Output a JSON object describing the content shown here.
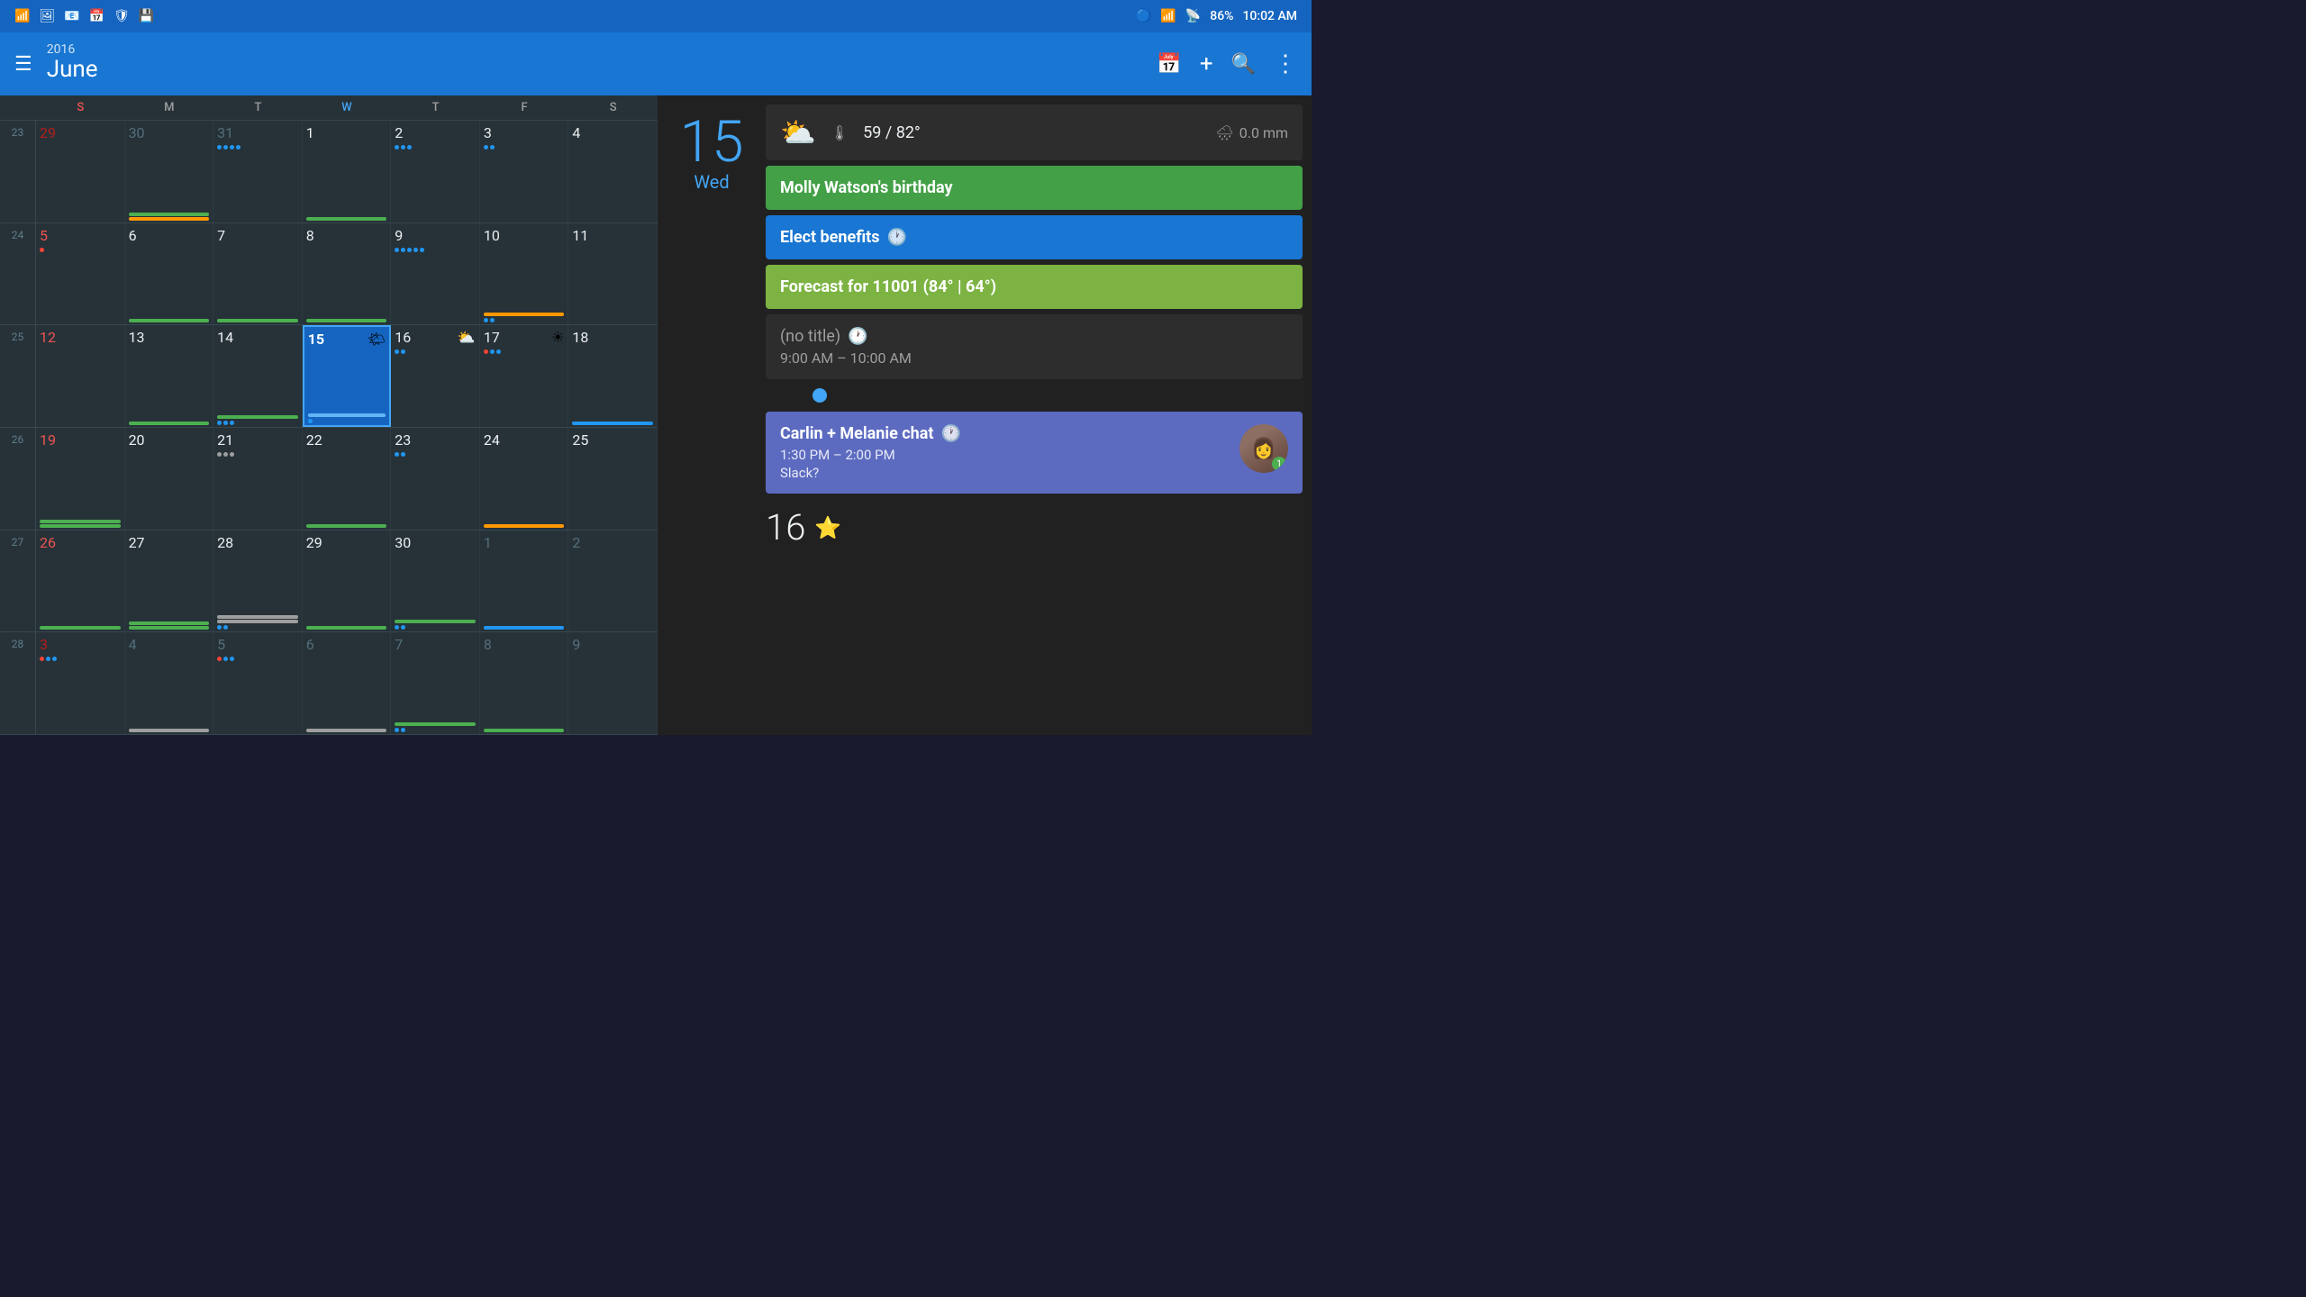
{
  "statusBar": {
    "leftIcons": [
      "wifi",
      "photo",
      "outlook",
      "calendar-sync",
      "shield",
      "drive"
    ],
    "bluetooth": "⚡",
    "wifi": "📶",
    "signal": "📡",
    "battery": "86%",
    "time": "10:02 AM"
  },
  "appBar": {
    "year": "2016",
    "month": "June",
    "menuIcon": "☰",
    "actions": {
      "calendarIcon": "📅",
      "addIcon": "+",
      "searchIcon": "🔍",
      "moreIcon": "⋮"
    }
  },
  "calendar": {
    "dayHeaders": [
      "S",
      "M",
      "T",
      "W",
      "T",
      "F",
      "S"
    ],
    "weeks": [
      {
        "weekNum": "23",
        "days": [
          {
            "num": "29",
            "type": "other-month",
            "dayType": "sunday"
          },
          {
            "num": "30",
            "type": "other-month",
            "bars": [
              "green",
              "orange"
            ]
          },
          {
            "num": "31",
            "type": "other-month",
            "dots": [
              "blue",
              "blue",
              "blue",
              "blue"
            ]
          },
          {
            "num": "1",
            "bars": [
              "green"
            ]
          },
          {
            "num": "2",
            "dots": [
              "blue",
              "blue",
              "blue"
            ]
          },
          {
            "num": "3",
            "dots": [
              "blue",
              "blue"
            ]
          },
          {
            "num": "4",
            "type": "saturday"
          }
        ]
      },
      {
        "weekNum": "24",
        "days": [
          {
            "num": "5",
            "dayType": "sunday-red",
            "dots": [
              "red"
            ]
          },
          {
            "num": "6",
            "bars": [
              "green"
            ]
          },
          {
            "num": "7",
            "bars": [
              "green"
            ]
          },
          {
            "num": "8",
            "bars": [
              "green"
            ]
          },
          {
            "num": "9",
            "dots": [
              "blue",
              "blue",
              "blue",
              "blue",
              "blue"
            ]
          },
          {
            "num": "10",
            "bars": [
              "orange"
            ],
            "dots": [
              "blue",
              "blue"
            ]
          },
          {
            "num": "11",
            "type": "saturday"
          }
        ]
      },
      {
        "weekNum": "25",
        "days": [
          {
            "num": "12",
            "dayType": "sunday-red"
          },
          {
            "num": "13",
            "bars": [
              "green"
            ]
          },
          {
            "num": "14",
            "bars": [
              "green"
            ],
            "dots": [
              "blue",
              "blue",
              "blue"
            ]
          },
          {
            "num": "15",
            "type": "today",
            "weather": "🌤"
          },
          {
            "num": "16",
            "dots": [
              "blue",
              "blue"
            ],
            "weather": "⛅"
          },
          {
            "num": "17",
            "weather": "☀",
            "dots": [
              "red",
              "blue",
              "blue"
            ]
          },
          {
            "num": "18",
            "bars": [
              "blue"
            ]
          }
        ]
      },
      {
        "weekNum": "26",
        "days": [
          {
            "num": "19",
            "dayType": "sunday-red",
            "bars": [
              "green",
              "green"
            ]
          },
          {
            "num": "20"
          },
          {
            "num": "21",
            "dots": [
              "gray",
              "gray",
              "gray"
            ]
          },
          {
            "num": "22",
            "bars": [
              "green"
            ]
          },
          {
            "num": "23",
            "dots": [
              "blue",
              "blue"
            ]
          },
          {
            "num": "24",
            "bars": [
              "orange"
            ]
          },
          {
            "num": "25",
            "type": "saturday"
          }
        ]
      },
      {
        "weekNum": "27",
        "days": [
          {
            "num": "26",
            "dayType": "sunday-red",
            "bars": [
              "green"
            ]
          },
          {
            "num": "27",
            "bars": [
              "green",
              "green"
            ]
          },
          {
            "num": "28",
            "bars": [
              "gray",
              "gray"
            ],
            "dots": [
              "blue",
              "blue"
            ]
          },
          {
            "num": "29",
            "bars": [
              "green"
            ]
          },
          {
            "num": "30",
            "bars": [
              "green"
            ],
            "dots": [
              "blue",
              "blue"
            ]
          },
          {
            "num": "1",
            "type": "other-month",
            "bars": [
              "blue"
            ]
          },
          {
            "num": "2",
            "type": "other-month saturday"
          }
        ]
      },
      {
        "weekNum": "28",
        "days": [
          {
            "num": "3",
            "type": "other-month",
            "dayType": "sunday-red",
            "dots": [
              "red",
              "blue",
              "blue"
            ]
          },
          {
            "num": "4",
            "type": "other-month",
            "bars": [
              "gray"
            ]
          },
          {
            "num": "5",
            "type": "other-month",
            "dots": [
              "red",
              "blue",
              "blue"
            ]
          },
          {
            "num": "6",
            "type": "other-month",
            "bars": [
              "gray"
            ]
          },
          {
            "num": "7",
            "type": "other-month",
            "bars": [
              "green"
            ],
            "dots": [
              "blue",
              "blue"
            ]
          },
          {
            "num": "8",
            "type": "other-month",
            "bars": [
              "green"
            ]
          },
          {
            "num": "9",
            "type": "other-month saturday"
          }
        ]
      }
    ]
  },
  "dayDetail": {
    "dayNum": "15",
    "dayName": "Wed",
    "weather": {
      "icon": "⛅",
      "tempRange": "59 / 82°",
      "precip": "0.0 mm"
    },
    "events": [
      {
        "id": "birthday",
        "title": "Molly Watson's birthday",
        "type": "green",
        "hasTime": false
      },
      {
        "id": "benefits",
        "title": "Elect benefits",
        "type": "blue",
        "hasClock": true
      },
      {
        "id": "forecast",
        "title": "Forecast for 11001 (84° | 64°)",
        "type": "lime",
        "hasTime": false
      },
      {
        "id": "notitle",
        "title": "(no title)",
        "type": "dim",
        "hasClock": true,
        "time": "9:00 AM – 10:00 AM"
      },
      {
        "id": "carlin",
        "title": "Carlin + Melanie chat",
        "type": "purple",
        "hasClock": true,
        "time": "1:30 PM – 2:00 PM",
        "subtitle": "Slack?",
        "hasAvatar": true,
        "avatarBadge": "1"
      }
    ],
    "nextDay": {
      "num": "16",
      "icon": "⭐"
    }
  }
}
